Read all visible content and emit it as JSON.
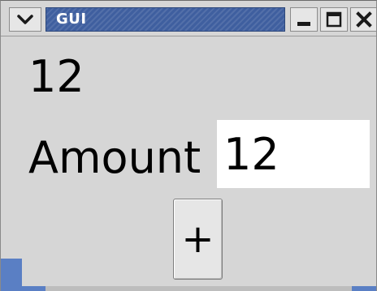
{
  "window": {
    "title": "GUI"
  },
  "content": {
    "count_value": "12",
    "amount_label": "Amount",
    "amount_value": "12",
    "plus_label": "+"
  }
}
